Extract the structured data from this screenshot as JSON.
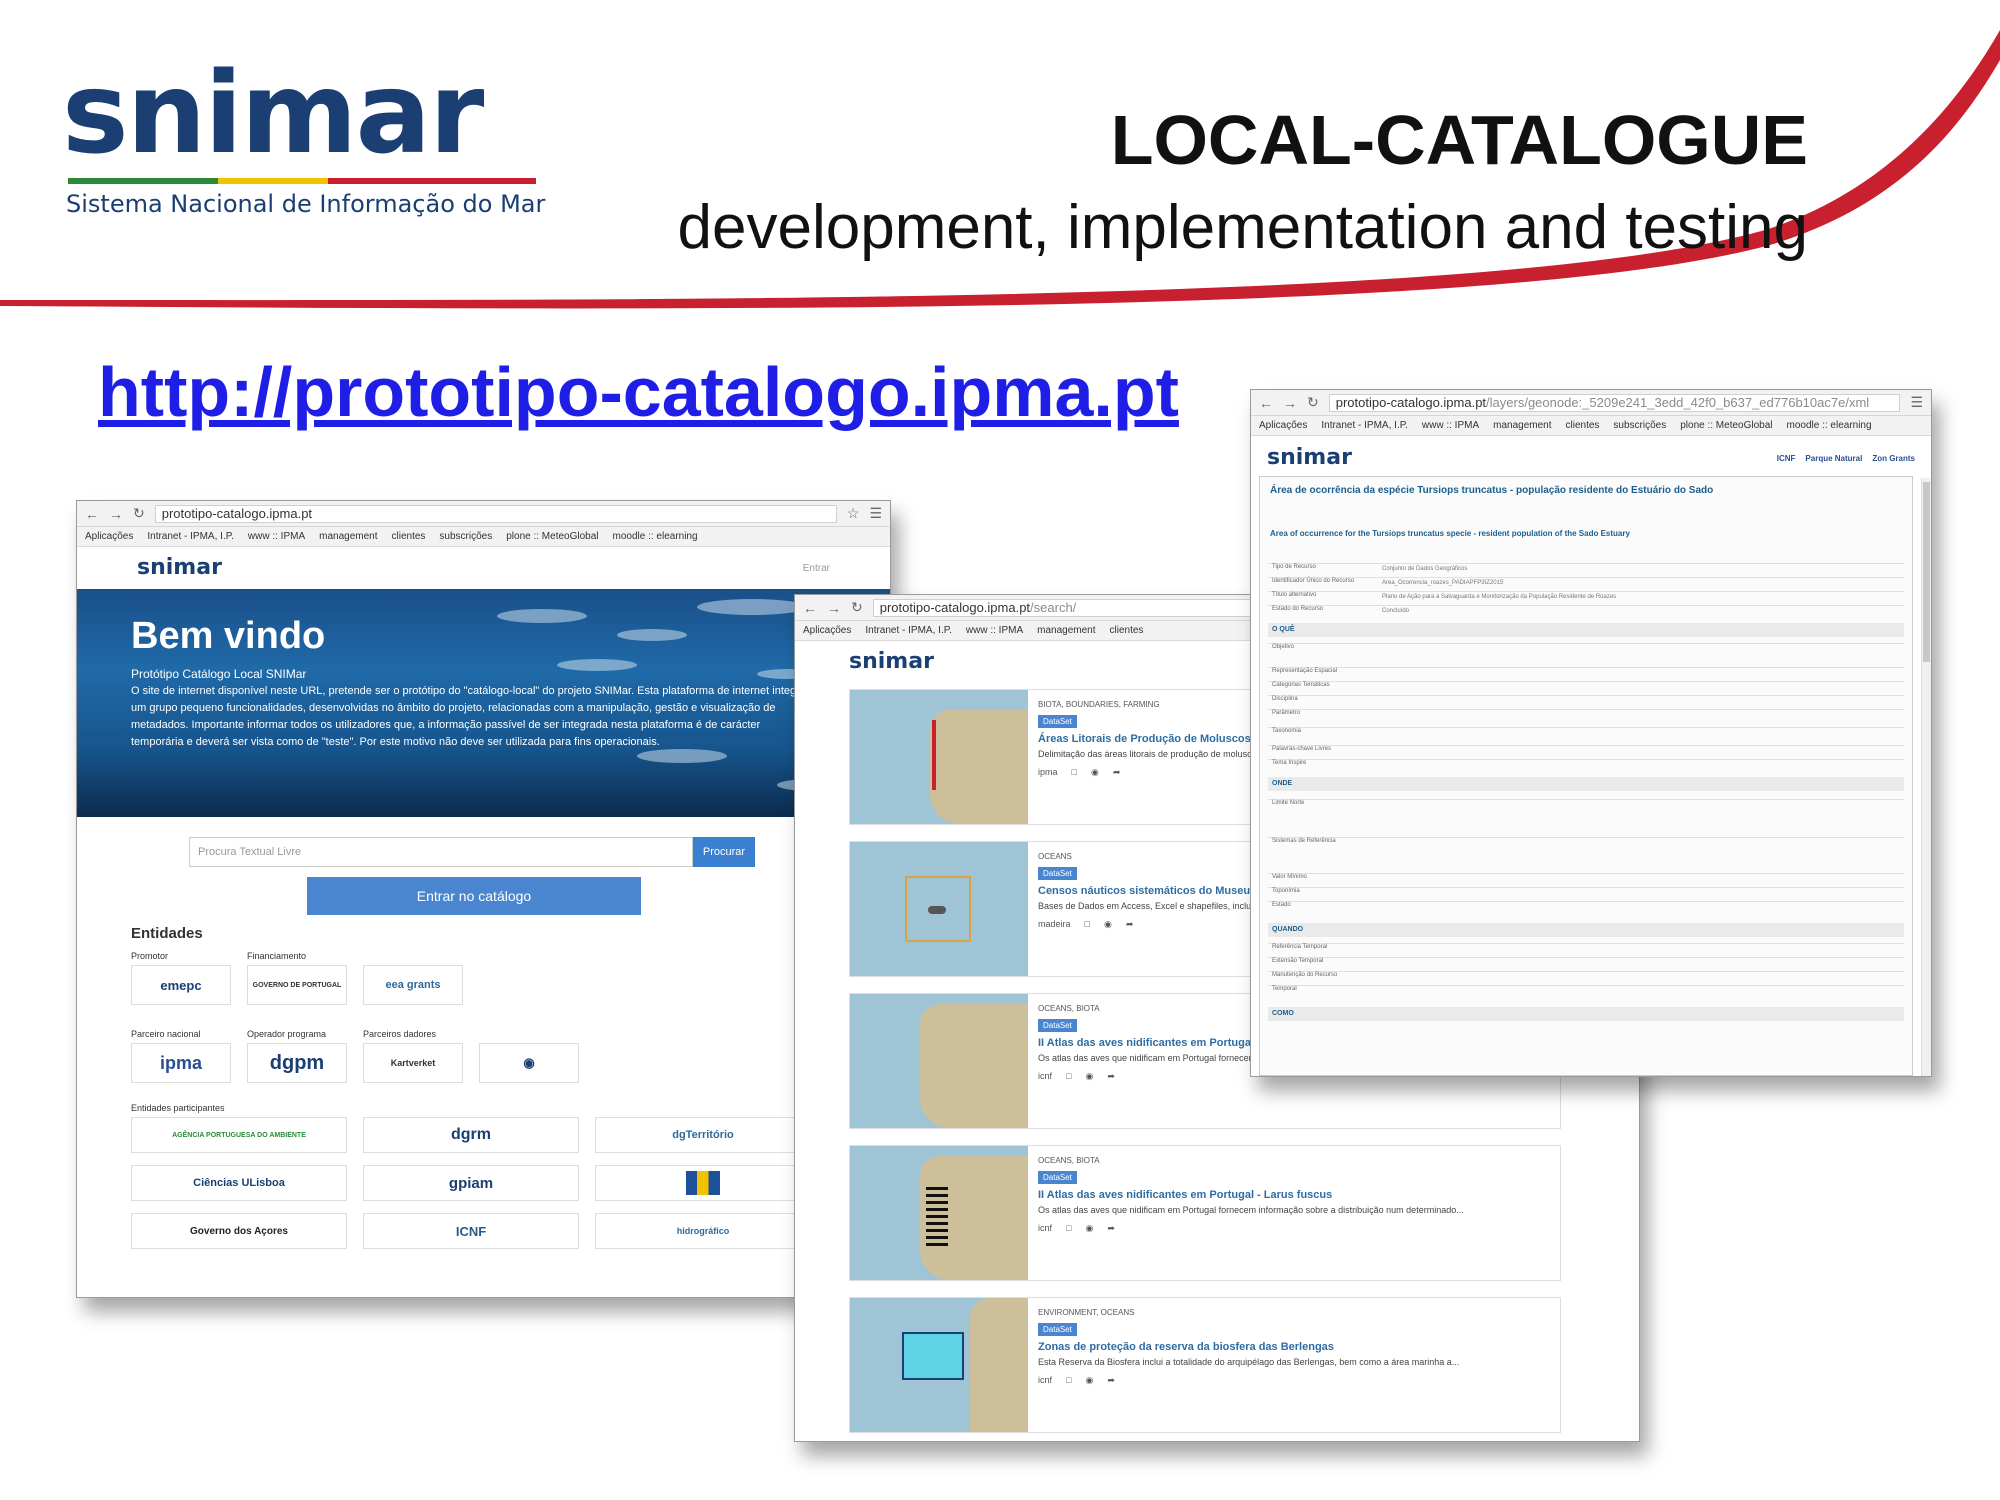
{
  "slide": {
    "logo_text": "snimar",
    "logo_subtitle": "Sistema Nacional de Informação do Mar",
    "title": "LOCAL-CATALOGUE",
    "subtitle": "development, implementation and testing",
    "url": "http://prototipo-catalogo.ipma.pt",
    "colors": {
      "accent_red": "#c8202f",
      "navy": "#1b3f73",
      "link": "#1e1ee6"
    }
  },
  "bookmarks": [
    "Aplicações",
    "Intranet - IPMA, I.P.",
    "www :: IPMA",
    "management",
    "clientes",
    "subscrições",
    "plone :: MeteoGlobal",
    "moodle :: elearning"
  ],
  "window1": {
    "url": "prototipo-catalogo.ipma.pt",
    "site_logo": "snimar",
    "login": "Entrar",
    "hero_title": "Bem vindo",
    "hero_sub": "Protótipo Catálogo Local SNIMar",
    "hero_desc": "O site de internet disponível neste URL, pretende ser o protótipo do \"catálogo-local\" do projeto SNIMar. Esta plataforma de internet integra um grupo pequeno funcionalidades, desenvolvidas no âmbito do projeto, relacionadas com a manipulação, gestão e visualização de metadados. Importante informar todos os utilizadores que, a informação passível de ser integrada nesta plataforma é de carácter temporária e deverá ser vista como de \"teste\". Por este motivo não deve ser utilizada para fins operacionais.",
    "search_placeholder": "Procura Textual Livre",
    "search_button": "Procurar",
    "enter_button": "Entrar no catálogo",
    "entities_title": "Entidades",
    "labels": {
      "promotor": "Promotor",
      "financiamento": "Financiamento",
      "parceiro": "Parceiro nacional",
      "operador": "Operador programa",
      "dadores": "Parceiros dadores",
      "participantes": "Entidades participantes"
    },
    "logos": {
      "emepc": "emepc",
      "portugal": "GOVERNO DE PORTUGAL",
      "eea": "eea grants",
      "ipma": "ipma",
      "dgpm": "dgpm",
      "kartverket": "Kartverket",
      "apa": "AGÊNCIA PORTUGUESA DO AMBIENTE",
      "dgrm": "dgrm",
      "dgterritorio": "dgTerritório",
      "ciencias": "Ciências ULisboa",
      "gpiam": "gpiam",
      "acores": "Governo dos Açores",
      "icnf": "ICNF",
      "hidrografico": "hidrográfico"
    }
  },
  "window2": {
    "url": "prototipo-catalogo.ipma.pt",
    "url_path": "/search/",
    "site_logo": "snimar",
    "results": [
      {
        "cat": "BIOTA, BOUNDARIES, FARMING",
        "tag": "DataSet",
        "title": "Áreas Litorais de Produção de Moluscos Bivalves 2015",
        "desc": "Delimitação das áreas litorais de produção de moluscos bivalves...",
        "owner": "ipma"
      },
      {
        "cat": "OCEANS",
        "tag": "DataSet",
        "title": "Censos náuticos sistemáticos do Museu da Baleia",
        "desc": "Bases de Dados em Access, Excel e shapefiles, incluindo...",
        "owner": "madeira"
      },
      {
        "cat": "OCEANS, BIOTA",
        "tag": "DataSet",
        "title": "II Atlas das aves nidificantes em Portugal - Larus michahellis",
        "desc": "Os atlas das aves que nidificam em Portugal fornecem informação sobre a distribuição...",
        "owner": "icnf"
      },
      {
        "cat": "OCEANS, BIOTA",
        "tag": "DataSet",
        "title": "II Atlas das aves nidificantes em Portugal - Larus fuscus",
        "desc": "Os atlas das aves que nidificam em Portugal fornecem informação sobre a distribuição num determinado...",
        "owner": "icnf"
      },
      {
        "cat": "ENVIRONMENT, OCEANS",
        "tag": "DataSet",
        "title": "Zonas de proteção da reserva da biosfera das Berlengas",
        "desc": "Esta Reserva da Biosfera inclui a totalidade do arquipélago das Berlengas, bem como a área marinha a...",
        "owner": "icnf"
      }
    ]
  },
  "window3": {
    "url": "prototipo-catalogo.ipma.pt",
    "url_path": "/layers/geonode:_5209e241_3edd_42f0_b637_ed776b10ac7e/xml",
    "site_logo": "snimar",
    "partners": [
      "ICNF",
      "Parque Natural",
      "Zon Grants"
    ],
    "title_pt": "Área de ocorrência da espécie Tursiops truncatus - população residente do Estuário do Sado",
    "title_en": "Area of occurrence for the Tursiops truncatus specie - resident population of the Sado Estuary",
    "sections": [
      "O QUÊ",
      "ONDE",
      "QUANDO",
      "COMO"
    ],
    "rows_what": [
      "Tipo de Recurso",
      "Identificador Único do Recurso",
      "Título alternativo",
      "Estado do Recurso"
    ],
    "rows_what_values": [
      "Conjunto de Dados Geográficos",
      "Area_Ocorrencia_roazes_PADIAPFP3IZ2015",
      "Plano de Ação para a Salvaguarda e Monitorização da População Residente de Roazes",
      "Concluído"
    ],
    "rows_what2": [
      "Objetivo",
      "Representação Espacial",
      "Categorias Temáticas",
      "Disciplina",
      "Parâmetro",
      "Taxonomia",
      "Palavras-chave Livres",
      "Tema Inspire"
    ],
    "rows_where": [
      "Limite Norte",
      "Sistemas de Referência",
      "Valor Mínimo",
      "Toponímia",
      "Estado"
    ],
    "rows_when": [
      "Referência Temporal",
      "Extensão Temporal",
      "Manutenção do Recurso",
      "Temporal"
    ]
  }
}
